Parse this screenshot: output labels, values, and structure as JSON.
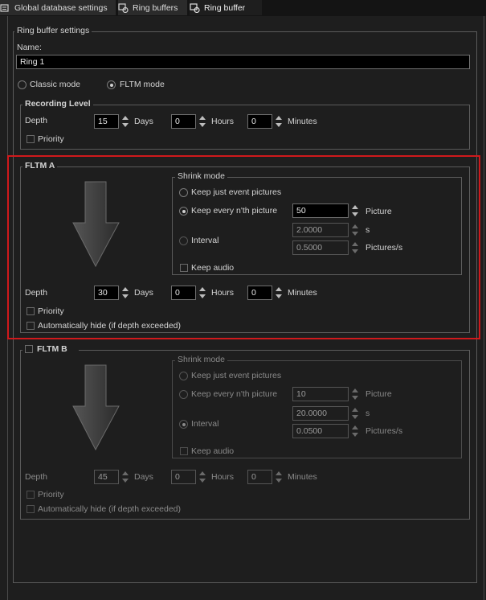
{
  "tabs": [
    {
      "label": "Global database settings",
      "icon": "database-settings-icon"
    },
    {
      "label": "Ring buffers",
      "icon": "ring-buffers-icon"
    },
    {
      "label": "Ring buffer",
      "icon": "ring-buffer-icon",
      "active": true
    }
  ],
  "settings": {
    "title": "Ring buffer settings",
    "name_label": "Name:",
    "name_value": "Ring 1",
    "mode_classic": "Classic mode",
    "mode_fltm": "FLTM mode",
    "selected_mode": "FLTM mode"
  },
  "recording": {
    "title": "Recording Level",
    "depth_label": "Depth",
    "days": "15",
    "days_label": "Days",
    "hours": "0",
    "hours_label": "Hours",
    "minutes": "0",
    "minutes_label": "Minutes",
    "priority_label": "Priority"
  },
  "fltm_a": {
    "title": "FLTM A",
    "shrink_title": "Shrink mode",
    "opt_event": "Keep just event pictures",
    "opt_nth": "Keep every n'th picture",
    "opt_interval": "Interval",
    "nth_value": "50",
    "picture_label": "Picture",
    "interval_s": "2.0000",
    "s_label": "s",
    "interval_rate": "0.5000",
    "rate_label": "Pictures/s",
    "keep_audio": "Keep audio",
    "selected": "Keep every n'th picture",
    "depth_label": "Depth",
    "days": "30",
    "days_label": "Days",
    "hours": "0",
    "hours_label": "Hours",
    "minutes": "0",
    "minutes_label": "Minutes",
    "priority_label": "Priority",
    "autohide_label": "Automatically hide (if depth exceeded)"
  },
  "fltm_b": {
    "title": "FLTM B",
    "shrink_title": "Shrink mode",
    "opt_event": "Keep just event pictures",
    "opt_nth": "Keep every n'th picture",
    "opt_interval": "Interval",
    "nth_value": "10",
    "picture_label": "Picture",
    "interval_s": "20.0000",
    "s_label": "s",
    "interval_rate": "0.0500",
    "rate_label": "Pictures/s",
    "keep_audio": "Keep audio",
    "selected": "Interval",
    "depth_label": "Depth",
    "days": "45",
    "days_label": "Days",
    "hours": "0",
    "hours_label": "Hours",
    "minutes": "0",
    "minutes_label": "Minutes",
    "priority_label": "Priority",
    "autohide_label": "Automatically hide (if depth exceeded)"
  },
  "colors": {
    "highlight": "#d0191c",
    "background": "#1e1e1e"
  }
}
